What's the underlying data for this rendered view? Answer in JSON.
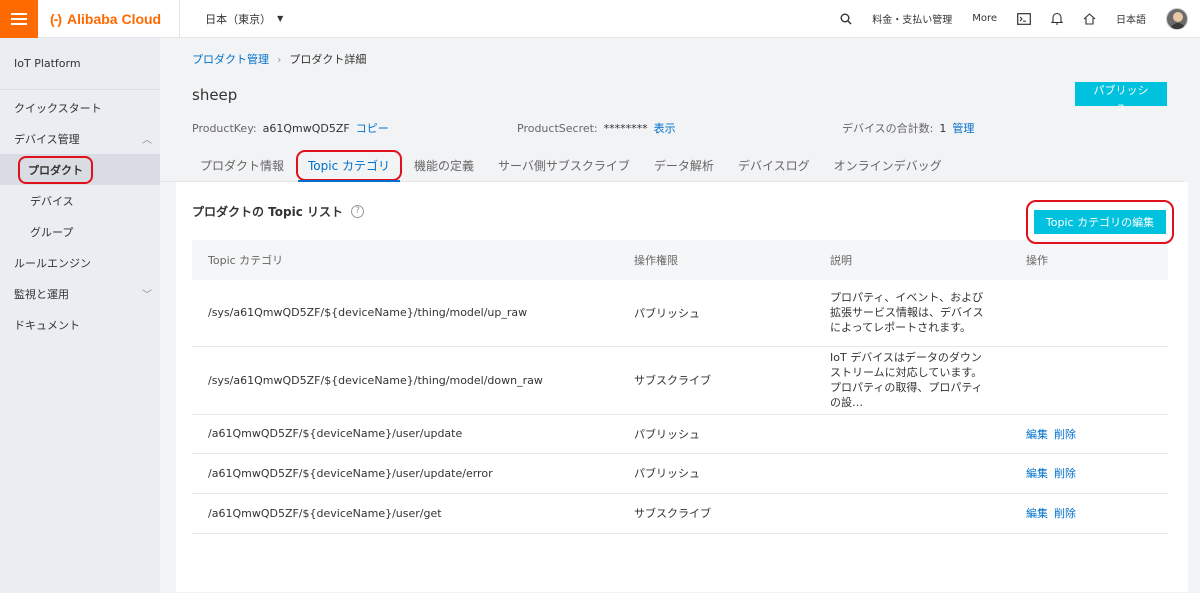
{
  "topbar": {
    "brand": "Alibaba Cloud",
    "brand_mark": "(-)",
    "region": "日本（東京）",
    "billing": "料金・支払い管理",
    "more": "More",
    "language": "日本語",
    "accent_color": "#ff6a00"
  },
  "sidebar": {
    "title": "IoT Platform",
    "items": [
      {
        "label": "クイックスタート"
      },
      {
        "label": "デバイス管理"
      },
      {
        "label": "プロダクト"
      },
      {
        "label": "デバイス"
      },
      {
        "label": "グループ"
      },
      {
        "label": "ルールエンジン"
      },
      {
        "label": "監視と運用"
      },
      {
        "label": "ドキュメント"
      }
    ]
  },
  "breadcrumb": {
    "parent": "プロダクト管理",
    "separator": "›",
    "current": "プロダクト詳細"
  },
  "product": {
    "name": "sheep",
    "publish_label": "パブリッシュ",
    "product_key_label": "ProductKey:",
    "product_key": "a61QmwQD5ZF",
    "copy_label": "コピー",
    "product_secret_label": "ProductSecret:",
    "product_secret": "********",
    "show_label": "表示",
    "device_total_label": "デバイスの合計数:",
    "device_total": "1",
    "manage_label": "管理"
  },
  "tabs": [
    {
      "label": "プロダクト情報"
    },
    {
      "label": "Topic カテゴリ"
    },
    {
      "label": "機能の定義"
    },
    {
      "label": "サーバ側サブスクライブ"
    },
    {
      "label": "データ解析"
    },
    {
      "label": "デバイスログ"
    },
    {
      "label": "オンラインデバッグ"
    }
  ],
  "topic_list": {
    "title": "プロダクトの Topic リスト",
    "edit_button": "Topic カテゴリの編集",
    "columns": [
      "Topic カテゴリ",
      "操作権限",
      "説明",
      "操作"
    ],
    "rows": [
      {
        "topic": "/sys/a61QmwQD5ZF/${deviceName}/thing/model/up_raw",
        "permission": "パブリッシュ",
        "description": "プロパティ、イベント、および拡張サービス情報は、デバイスによってレポートされます。",
        "edit": "",
        "delete": ""
      },
      {
        "topic": "/sys/a61QmwQD5ZF/${deviceName}/thing/model/down_raw",
        "permission": "サブスクライブ",
        "description": "IoT デバイスはデータのダウンストリームに対応しています。プロパティの取得、プロパティの設…",
        "edit": "",
        "delete": ""
      },
      {
        "topic": "/a61QmwQD5ZF/${deviceName}/user/update",
        "permission": "パブリッシュ",
        "description": "",
        "edit": "編集",
        "delete": "削除"
      },
      {
        "topic": "/a61QmwQD5ZF/${deviceName}/user/update/error",
        "permission": "パブリッシュ",
        "description": "",
        "edit": "編集",
        "delete": "削除"
      },
      {
        "topic": "/a61QmwQD5ZF/${deviceName}/user/get",
        "permission": "サブスクライブ",
        "description": "",
        "edit": "編集",
        "delete": "削除"
      }
    ]
  }
}
